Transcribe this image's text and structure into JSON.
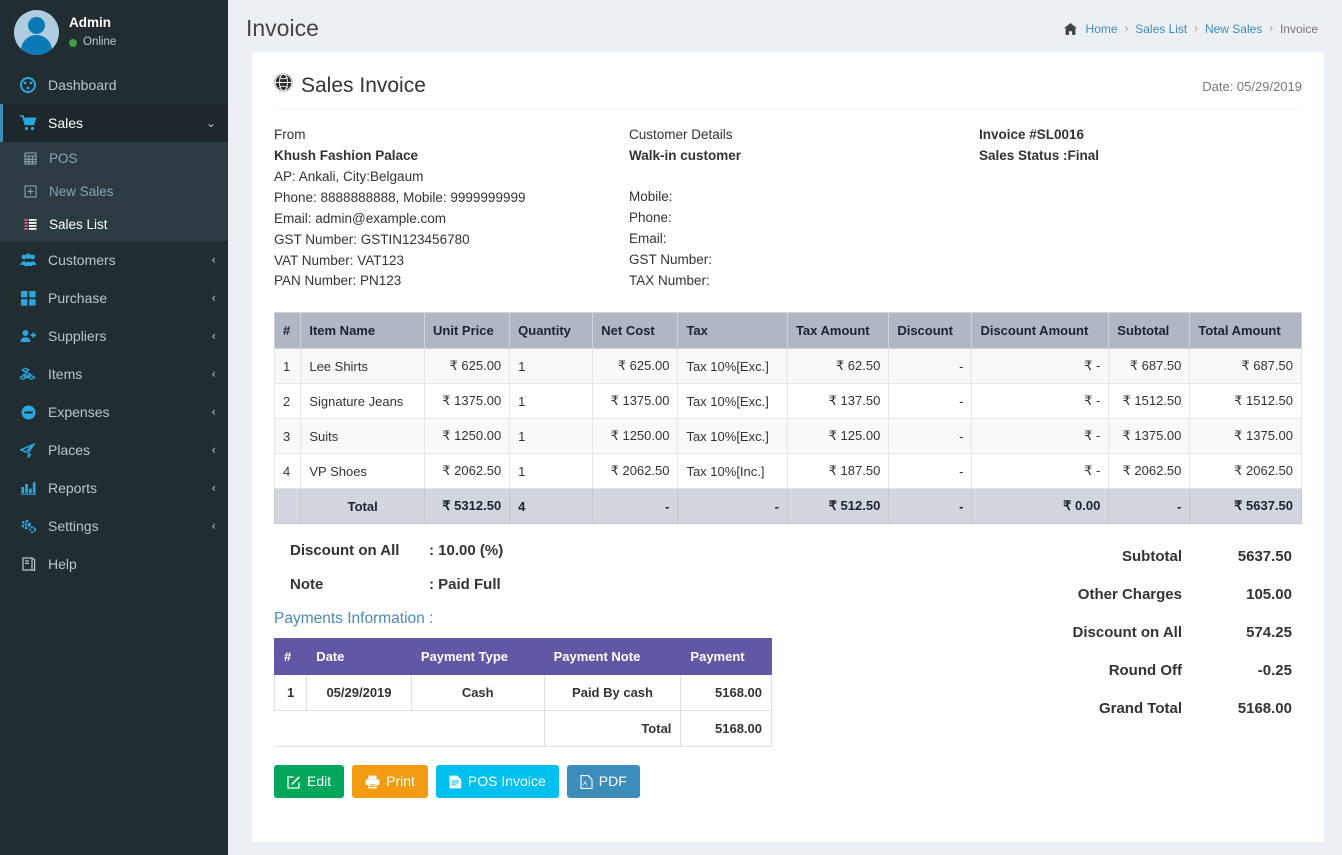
{
  "sidebar": {
    "user": {
      "name": "Admin",
      "status": "Online"
    },
    "items": [
      {
        "label": "Dashboard",
        "icon": "dashboard-icon",
        "has_arrow": false,
        "active": false
      },
      {
        "label": "Sales",
        "icon": "cart-icon",
        "has_arrow": true,
        "active": true
      },
      {
        "label": "Customers",
        "icon": "users-icon",
        "has_arrow": true,
        "active": false
      },
      {
        "label": "Purchase",
        "icon": "grid-icon",
        "has_arrow": true,
        "active": false
      },
      {
        "label": "Suppliers",
        "icon": "user-plus-icon",
        "has_arrow": true,
        "active": false
      },
      {
        "label": "Items",
        "icon": "cubes-icon",
        "has_arrow": true,
        "active": false
      },
      {
        "label": "Expenses",
        "icon": "minus-circle-icon",
        "has_arrow": true,
        "active": false
      },
      {
        "label": "Places",
        "icon": "paper-plane-icon",
        "has_arrow": true,
        "active": false
      },
      {
        "label": "Reports",
        "icon": "bar-chart-icon",
        "has_arrow": true,
        "active": false
      },
      {
        "label": "Settings",
        "icon": "gears-icon",
        "has_arrow": true,
        "active": false
      },
      {
        "label": "Help",
        "icon": "book-icon",
        "has_arrow": false,
        "active": false
      }
    ],
    "submenu": [
      {
        "label": "POS",
        "icon": "calculator-icon",
        "active": false
      },
      {
        "label": "New Sales",
        "icon": "plus-square-icon",
        "active": false
      },
      {
        "label": "Sales List",
        "icon": "list-icon",
        "active": true
      }
    ]
  },
  "header": {
    "title": "Invoice",
    "breadcrumb": [
      "Home",
      "Sales List",
      "New Sales",
      "Invoice"
    ]
  },
  "invoice": {
    "title": "Sales Invoice",
    "date_label": "Date: 05/29/2019",
    "from": {
      "label": "From",
      "company": "Khush Fashion Palace",
      "address": "AP: Ankali, City:Belgaum",
      "phone": "Phone: 8888888888, Mobile: 9999999999",
      "email": "Email: admin@example.com",
      "gst": "GST Number: GSTIN123456780",
      "vat": "VAT Number: VAT123",
      "pan": "PAN Number: PN123"
    },
    "customer": {
      "label": "Customer Details",
      "name": "Walk-in customer",
      "mobile": "Mobile:",
      "phone": "Phone:",
      "email": "Email:",
      "gst": "GST Number:",
      "tax": "TAX Number:"
    },
    "meta": {
      "invoice_no": "Invoice #SL0016",
      "status": "Sales Status :Final"
    }
  },
  "items_table": {
    "headers": [
      "#",
      "Item Name",
      "Unit Price",
      "Quantity",
      "Net Cost",
      "Tax",
      "Tax Amount",
      "Discount",
      "Discount Amount",
      "Subtotal",
      "Total Amount"
    ],
    "rows": [
      {
        "idx": "1",
        "name": "Lee Shirts",
        "unit_price": "₹ 625.00",
        "quantity": "1",
        "net_cost": "₹ 625.00",
        "tax": "Tax 10%[Exc.]",
        "tax_amount": "₹ 62.50",
        "discount": "-",
        "discount_amount": "₹ -",
        "subtotal": "₹ 687.50",
        "total_amount": "₹ 687.50"
      },
      {
        "idx": "2",
        "name": "Signature Jeans",
        "unit_price": "₹ 1375.00",
        "quantity": "1",
        "net_cost": "₹ 1375.00",
        "tax": "Tax 10%[Exc.]",
        "tax_amount": "₹ 137.50",
        "discount": "-",
        "discount_amount": "₹ -",
        "subtotal": "₹ 1512.50",
        "total_amount": "₹ 1512.50"
      },
      {
        "idx": "3",
        "name": "Suits",
        "unit_price": "₹ 1250.00",
        "quantity": "1",
        "net_cost": "₹ 1250.00",
        "tax": "Tax 10%[Exc.]",
        "tax_amount": "₹ 125.00",
        "discount": "-",
        "discount_amount": "₹ -",
        "subtotal": "₹ 1375.00",
        "total_amount": "₹ 1375.00"
      },
      {
        "idx": "4",
        "name": "VP Shoes",
        "unit_price": "₹ 2062.50",
        "quantity": "1",
        "net_cost": "₹ 2062.50",
        "tax": "Tax 10%[Inc.]",
        "tax_amount": "₹ 187.50",
        "discount": "-",
        "discount_amount": "₹ -",
        "subtotal": "₹ 2062.50",
        "total_amount": "₹ 2062.50"
      }
    ],
    "total_row": {
      "label": "Total",
      "unit_price": "₹ 5312.50",
      "quantity": "4",
      "net_cost": "-",
      "tax": "-",
      "tax_amount": "₹ 512.50",
      "discount": "-",
      "discount_amount": "₹ 0.00",
      "subtotal": "-",
      "total_amount": "₹ 5637.50"
    }
  },
  "details": {
    "discount_on_all_key": "Discount on All",
    "discount_on_all_val": ": 10.00 (%)",
    "note_key": "Note",
    "note_val": ": Paid Full"
  },
  "payments": {
    "title": "Payments Information :",
    "headers": [
      "#",
      "Date",
      "Payment Type",
      "Payment Note",
      "Payment"
    ],
    "rows": [
      {
        "idx": "1",
        "date": "05/29/2019",
        "type": "Cash",
        "note": "Paid By cash",
        "amount": "5168.00"
      }
    ],
    "total_label": "Total",
    "total_amount": "5168.00"
  },
  "summary": [
    {
      "label": "Subtotal",
      "value": "5637.50"
    },
    {
      "label": "Other Charges",
      "value": "105.00"
    },
    {
      "label": "Discount on All",
      "value": "574.25"
    },
    {
      "label": "Round Off",
      "value": "-0.25"
    },
    {
      "label": "Grand Total",
      "value": "5168.00"
    }
  ],
  "buttons": {
    "edit": "Edit",
    "print": "Print",
    "pos_invoice": "POS Invoice",
    "pdf": "PDF"
  },
  "colors": {
    "sidebar_bg": "#222d32",
    "sidebar_accent": "#3c8dbc",
    "icon_blue": "#29a8e0",
    "page_bg": "#ecf0f5",
    "items_header_bg": "#b0b7c3",
    "total_row_bg": "#d2d6de",
    "payments_header_bg": "#6158a5",
    "link_blue": "#4a8bb5",
    "btn_edit": "#00a65a",
    "btn_print": "#f39c12",
    "btn_pos": "#00c0ef",
    "btn_pdf": "#3c8dbc"
  }
}
